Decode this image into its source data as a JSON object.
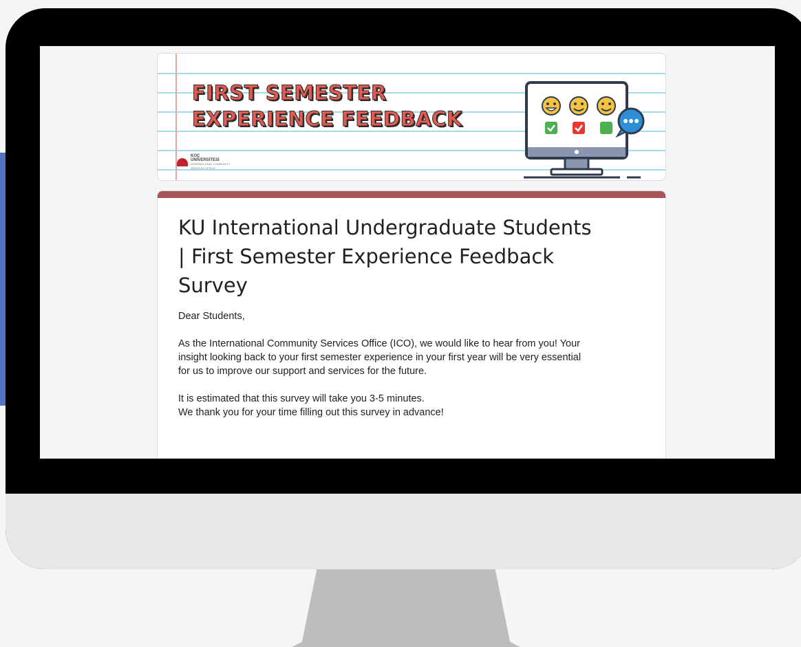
{
  "banner": {
    "title_line1": "FIRST SEMESTER",
    "title_line2": "EXPERIENCE FEEDBACK",
    "logo_line1": "KOÇ",
    "logo_line2": "ÜNİVERSİTESİ",
    "logo_line3": "INTERNATIONAL COMMUNITY",
    "logo_line4": "SERVICES OFFICE"
  },
  "form": {
    "title_line1": "KU International Undergraduate Students",
    "title_line2": "| First Semester Experience Feedback",
    "title_line3": "Survey",
    "greeting": "Dear Students,",
    "intro_line1": "As the International Community Services Office (ICO), we would like to hear from you! Your",
    "intro_line2": "insight looking back to your first semester experience in your first year will be very essential",
    "intro_line3": "for us to improve our support and services for the future.",
    "estimate_line1": "It is estimated that this survey will take you 3-5 minutes.",
    "estimate_line2": "We thank you for your time filling out this survey in advance!"
  },
  "colors": {
    "accent": "#a85558",
    "banner_title": "#e25b52",
    "side_band": "#5573c4"
  },
  "icons": [
    "computer-monitor-icon",
    "smiley-face-icon",
    "checkbox-icon",
    "chat-bubble-icon",
    "koc-university-logo"
  ]
}
